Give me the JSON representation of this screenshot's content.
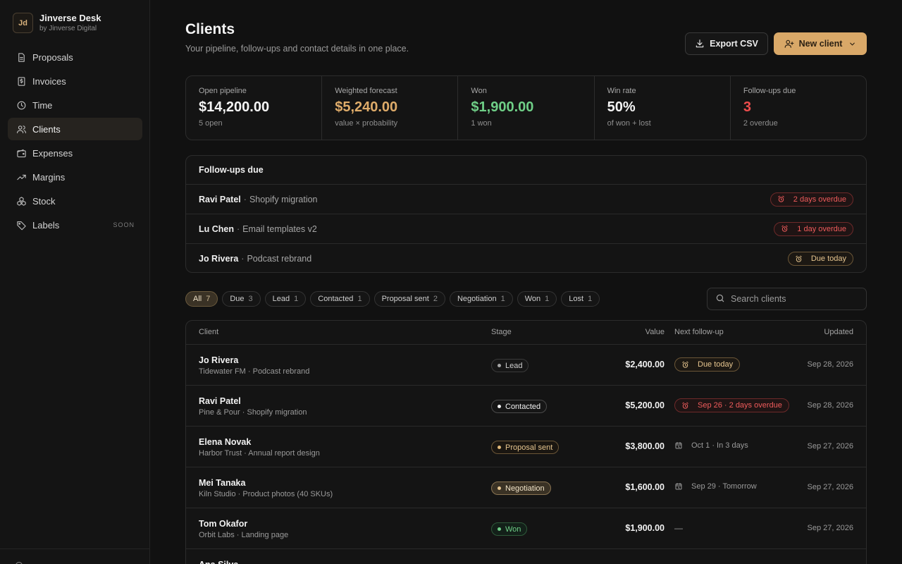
{
  "brand": {
    "logo": "Jd",
    "name": "Jinverse Desk",
    "sub": "by Jinverse Digital"
  },
  "nav": [
    {
      "label": "Proposals",
      "icon": "document-icon"
    },
    {
      "label": "Invoices",
      "icon": "invoice-icon"
    },
    {
      "label": "Time",
      "icon": "clock-icon"
    },
    {
      "label": "Clients",
      "icon": "users-icon",
      "active": true
    },
    {
      "label": "Expenses",
      "icon": "wallet-icon"
    },
    {
      "label": "Margins",
      "icon": "trending-up-icon"
    },
    {
      "label": "Stock",
      "icon": "boxes-icon"
    },
    {
      "label": "Labels",
      "icon": "tag-icon",
      "badge": "SOON"
    }
  ],
  "header": {
    "title": "Clients",
    "subtitle": "Your pipeline, follow-ups and contact details in one place.",
    "export_label": "Export CSV",
    "new_label": "New client"
  },
  "stats": [
    {
      "label": "Open pipeline",
      "value": "$14,200.00",
      "note": "5 open",
      "color": "#f4f4f4"
    },
    {
      "label": "Weighted forecast",
      "value": "$5,240.00",
      "note": "value × probability",
      "color": "#dfac6a"
    },
    {
      "label": "Won",
      "value": "$1,900.00",
      "note": "1 won",
      "color": "#6fcf87"
    },
    {
      "label": "Win rate",
      "value": "50%",
      "note": "of won + lost",
      "color": "#f4f4f4"
    },
    {
      "label": "Follow-ups due",
      "value": "3",
      "note": "2 overdue",
      "color": "#ee4d4d"
    }
  ],
  "followups": {
    "title": "Follow-ups due",
    "items": [
      {
        "name": "Ravi Patel",
        "project": "Shopify migration",
        "status": "2 days overdue",
        "tone": "red"
      },
      {
        "name": "Lu Chen",
        "project": "Email templates v2",
        "status": "1 day overdue",
        "tone": "red"
      },
      {
        "name": "Jo Rivera",
        "project": "Podcast rebrand",
        "status": "Due today",
        "tone": "amber"
      }
    ]
  },
  "filters": [
    {
      "label": "All",
      "count": "7",
      "active": true
    },
    {
      "label": "Due",
      "count": "3"
    },
    {
      "label": "Lead",
      "count": "1"
    },
    {
      "label": "Contacted",
      "count": "1"
    },
    {
      "label": "Proposal sent",
      "count": "2"
    },
    {
      "label": "Negotiation",
      "count": "1"
    },
    {
      "label": "Won",
      "count": "1"
    },
    {
      "label": "Lost",
      "count": "1"
    }
  ],
  "search": {
    "placeholder": "Search clients"
  },
  "table": {
    "columns": {
      "client": "Client",
      "stage": "Stage",
      "value": "Value",
      "follow": "Next follow-up",
      "updated": "Updated"
    },
    "rows": [
      {
        "name": "Jo Rivera",
        "sub": "Tidewater FM · Podcast rebrand",
        "stage": "Lead",
        "stage_kind": "lead",
        "value": "$2,400.00",
        "follow": "Due today",
        "follow_kind": "amber",
        "updated": "Sep 28, 2026"
      },
      {
        "name": "Ravi Patel",
        "sub": "Pine & Pour · Shopify migration",
        "stage": "Contacted",
        "stage_kind": "contacted",
        "value": "$5,200.00",
        "follow": "Sep 26 · 2 days overdue",
        "follow_kind": "red",
        "updated": "Sep 28, 2026"
      },
      {
        "name": "Elena Novak",
        "sub": "Harbor Trust · Annual report design",
        "stage": "Proposal sent",
        "stage_kind": "proposal",
        "value": "$3,800.00",
        "follow": "Oct 1 · In 3 days",
        "follow_kind": "plain",
        "updated": "Sep 27, 2026"
      },
      {
        "name": "Mei Tanaka",
        "sub": "Kiln Studio · Product photos (40 SKUs)",
        "stage": "Negotiation",
        "stage_kind": "negotiation",
        "value": "$1,600.00",
        "follow": "Sep 29 · Tomorrow",
        "follow_kind": "plain",
        "updated": "Sep 27, 2026"
      },
      {
        "name": "Tom Okafor",
        "sub": "Orbit Labs · Landing page",
        "stage": "Won",
        "stage_kind": "won",
        "value": "$1,900.00",
        "follow": "—",
        "follow_kind": "none",
        "updated": "Sep 27, 2026"
      },
      {
        "name": "Ana Silva",
        "sub": "",
        "stage": "",
        "stage_kind": "lost",
        "value": "",
        "follow": "",
        "follow_kind": "none",
        "updated": ""
      }
    ]
  },
  "colors": {
    "accent": "#d9a868",
    "green": "#6fcf87",
    "red": "#ee5b5b",
    "bg": "#111111"
  }
}
